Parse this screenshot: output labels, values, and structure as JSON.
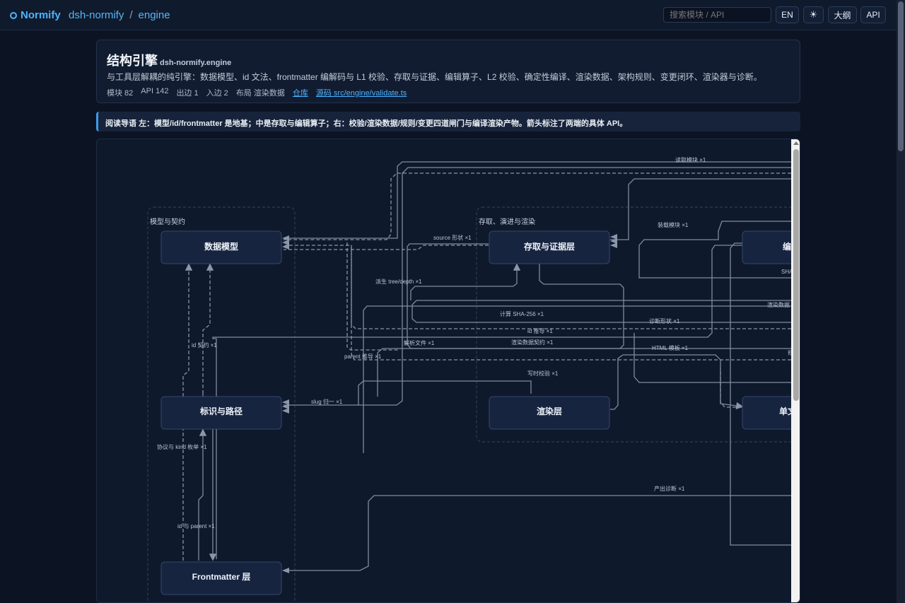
{
  "topbar": {
    "brand": "Normify",
    "crumb_repo": "dsh-normify",
    "crumb_sep": "/",
    "crumb_page": "engine",
    "search_placeholder": "搜索模块 / API",
    "btn_lang": "EN",
    "btn_theme_icon": "sun-icon",
    "btn_theme": "☀",
    "btn_outline": "大纲",
    "btn_api": "API"
  },
  "header": {
    "title": "结构引擎",
    "subtitle": "dsh-normify.engine",
    "description": "与工具层解耦的纯引擎：数据模型、id 文法、frontmatter 编解码与 L1 校验、存取与证据、编辑算子、L2 校验、确定性编译、渲染数据、架构规则、变更闭环、渲染器与诊断。",
    "meta": {
      "modules": "模块 82",
      "api": "API 142",
      "out_edges": "出边 1",
      "in_edges": "入边 2",
      "layout": "布局 渲染数据",
      "repo_link": "仓库",
      "source_link": "源码 src/engine/validate.ts"
    }
  },
  "guide": {
    "label": "阅读导语",
    "text": "左：模型/id/frontmatter 是地基；中是存取与编辑算子；右：校验/渲染数据/规则/变更四道闸门与编译渲染产物。箭头标注了两端的具体 API。"
  },
  "diagram": {
    "groups": {
      "model": "模型与契约",
      "store": "存取、演进与渲染"
    },
    "nodes": {
      "data_model": "数据模型",
      "id_path": "标识与路径",
      "frontmatter": "Frontmatter 层",
      "store_evidence": "存取与证据层",
      "render_layer": "渲染层",
      "edit_partial": "编",
      "single_partial": "单文"
    },
    "edges": {
      "read_module": "读取模块 ×1",
      "load_module": "装载模块 ×1",
      "source_shape": "source 形状 ×1",
      "derive_tree": "派生 tree/depth ×1",
      "sha_partial": "SHA",
      "render_data_partial": "渲染数据",
      "compute_sha": "计算 SHA-256 ×1",
      "diag_shape": "诊断形状 ×1",
      "id_contract": "id 契约 ×1",
      "id_derive": "id 推导 ×1",
      "parse_file": "解析文件 ×1",
      "render_contract": "渲染数据契约 ×1",
      "html_template": "HTML 模板 ×1",
      "parent_derive": "parent 推导 ×1",
      "right_partial": "规",
      "write_check": "写时校验 ×1",
      "slug_norm": "slug 归一 ×1",
      "protocol_kind": "协议与 kind 枚举 ×1",
      "output_diag": "产出诊断 ×1",
      "id_parent": "id 与 parent ×1"
    }
  }
}
